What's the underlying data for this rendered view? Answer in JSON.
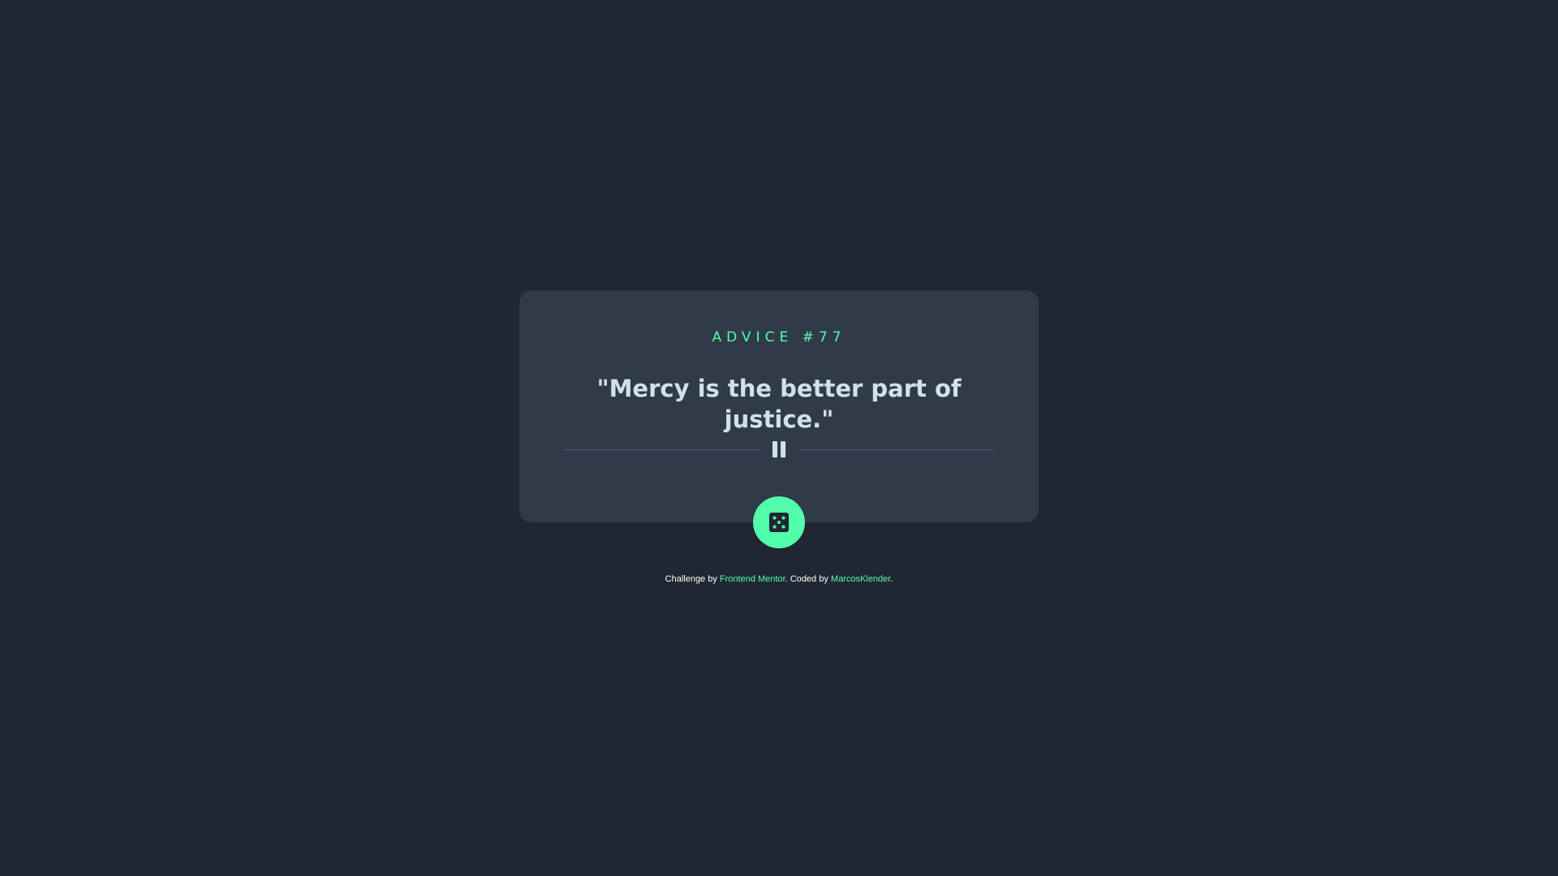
{
  "card": {
    "label": "Advice #77",
    "quote": "\"Mercy is the better part of justice.\""
  },
  "dice_button": {
    "icon": "dice-icon"
  },
  "divider": {
    "icon": "pause-icon"
  },
  "footer": {
    "prefix": "Challenge by ",
    "link1": "Frontend Mentor",
    "middle": ". Coded by ",
    "link2": "MarcosKlender",
    "suffix": "."
  },
  "colors": {
    "background": "#202632",
    "card": "#313a49",
    "accent": "#53ffaa",
    "text": "#cee3e9",
    "divider": "#4f5d74"
  }
}
